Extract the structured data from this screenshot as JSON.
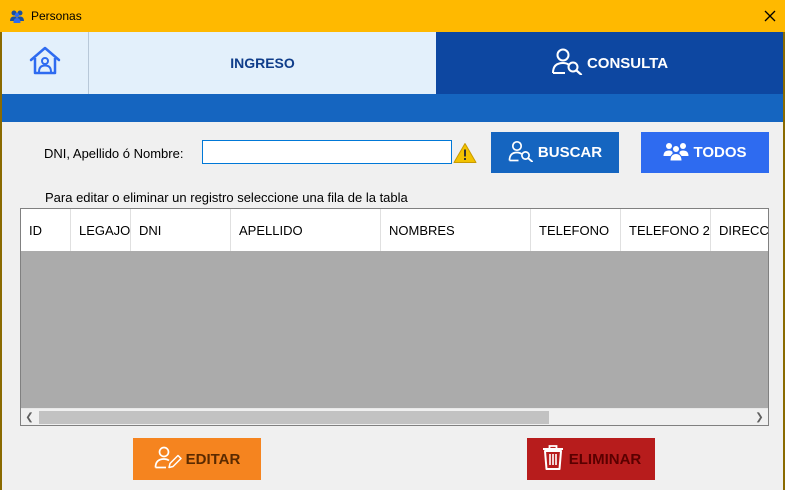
{
  "window": {
    "title": "Personas",
    "icon": "people-icon",
    "accent": "#ffb900"
  },
  "nav": {
    "home_icon": "home-icon",
    "ingreso_label": "INGRESO",
    "consulta_label": "CONSULTA",
    "consulta_icon": "user-search-icon",
    "active_tab": "CONSULTA"
  },
  "search": {
    "label": "DNI, Apellido ó Nombre:",
    "value": "",
    "warning_icon": "warning-icon"
  },
  "buttons": {
    "buscar": "BUSCAR",
    "todos": "TODOS",
    "editar": "EDITAR",
    "eliminar": "ELIMINAR"
  },
  "hint": "Para editar o eliminar un registro seleccione una fila de la tabla",
  "table": {
    "columns": [
      "ID",
      "LEGAJO",
      "DNI",
      "APELLIDO",
      "NOMBRES",
      "TELEFONO",
      "TELEFONO 2",
      "DIRECCION"
    ],
    "rows": []
  },
  "colors": {
    "nav_active": "#0d47a1",
    "nav_inactive": "#e3f0fb",
    "buscar": "#1565c0",
    "todos": "#2e6bf0",
    "editar": "#f5841f",
    "eliminar": "#b71c1c"
  }
}
